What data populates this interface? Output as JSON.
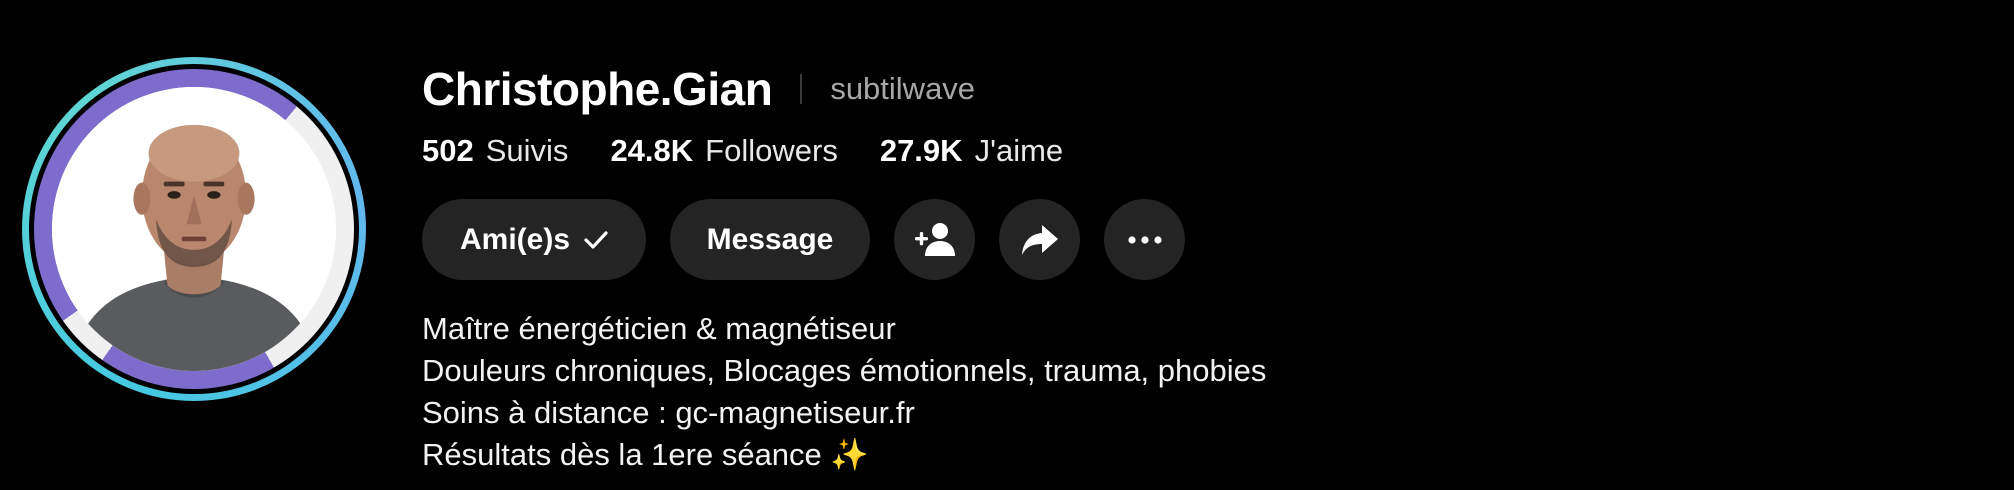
{
  "profile": {
    "display_name": "Christophe.Gian",
    "username": "subtilwave"
  },
  "stats": [
    {
      "value": "502",
      "label": "Suivis"
    },
    {
      "value": "24.8K",
      "label": "Followers"
    },
    {
      "value": "27.9K",
      "label": "J'aime"
    }
  ],
  "actions": {
    "friends_label": "Ami(e)s",
    "message_label": "Message",
    "add_friend_icon": "person-add-icon",
    "share_icon": "share-arrow-icon",
    "more_icon": "more-horizontal-icon"
  },
  "bio": [
    "Maître énergéticien & magnétiseur",
    "Douleurs chroniques, Blocages émotionnels, trauma, phobies",
    "Soins à distance : gc-magnetiseur.fr",
    "Résultats dès la 1ere séance ✨"
  ],
  "colors": {
    "background": "#000000",
    "button_bg": "#242424",
    "avatar_ring": "#45c9e0",
    "avatar_frame": "#7d6ccc",
    "username": "#a7a7a7"
  }
}
